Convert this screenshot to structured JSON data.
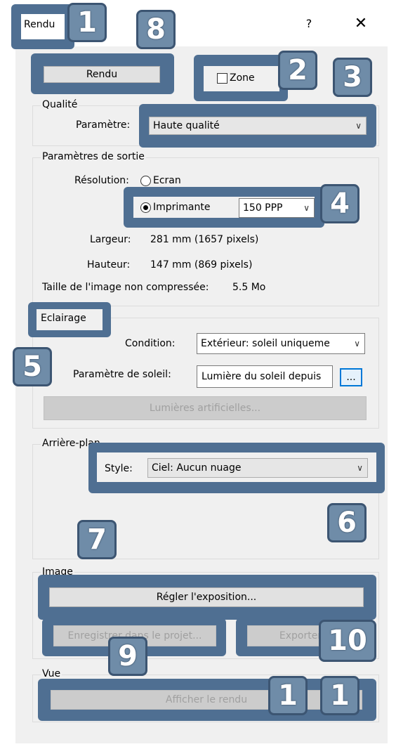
{
  "window": {
    "title": "Rendu",
    "help_label": "?",
    "close_label": "✕"
  },
  "render_button": "Rendu",
  "zone": {
    "label": "Zone",
    "checked": false
  },
  "quality": {
    "group": "Qualité",
    "param_label": "Paramètre:",
    "value": "Haute qualité"
  },
  "output": {
    "group": "Paramètres de sortie",
    "resolution_label": "Résolution:",
    "screen_option": "Ecran",
    "printer_option": "Imprimante",
    "dpi": "150 PPP",
    "width_label": "Largeur:",
    "width_value": "281 mm (1657 pixels)",
    "height_label": "Hauteur:",
    "height_value": "147 mm (869 pixels)",
    "size_label": "Taille de l'image non compressée:",
    "size_value": "5.5 Mo"
  },
  "lighting": {
    "group": "Eclairage",
    "condition_label": "Condition:",
    "condition_value": "Extérieur: soleil uniqueme",
    "sun_label": "Paramètre de soleil:",
    "sun_value": "Lumière du soleil depuis",
    "more_label": "...",
    "artificial_button": "Lumières artificielles..."
  },
  "background": {
    "group": "Arrière-plan",
    "style_label": "Style:",
    "style_value": "Ciel: Aucun nuage"
  },
  "image": {
    "group": "Image",
    "exposure_button": "Régler l'exposition...",
    "save_button": "Enregistrer dans le projet...",
    "export_button": "Exporter..."
  },
  "view": {
    "group": "Vue",
    "show_button": "Afficher le rendu"
  },
  "badges": [
    "1",
    "2",
    "3",
    "4",
    "5",
    "6",
    "7",
    "8",
    "9",
    "10",
    "1",
    "1"
  ],
  "colors": {
    "callout": "#4f6f92",
    "badge": "#6f8ca8",
    "focus": "#0078d7"
  }
}
